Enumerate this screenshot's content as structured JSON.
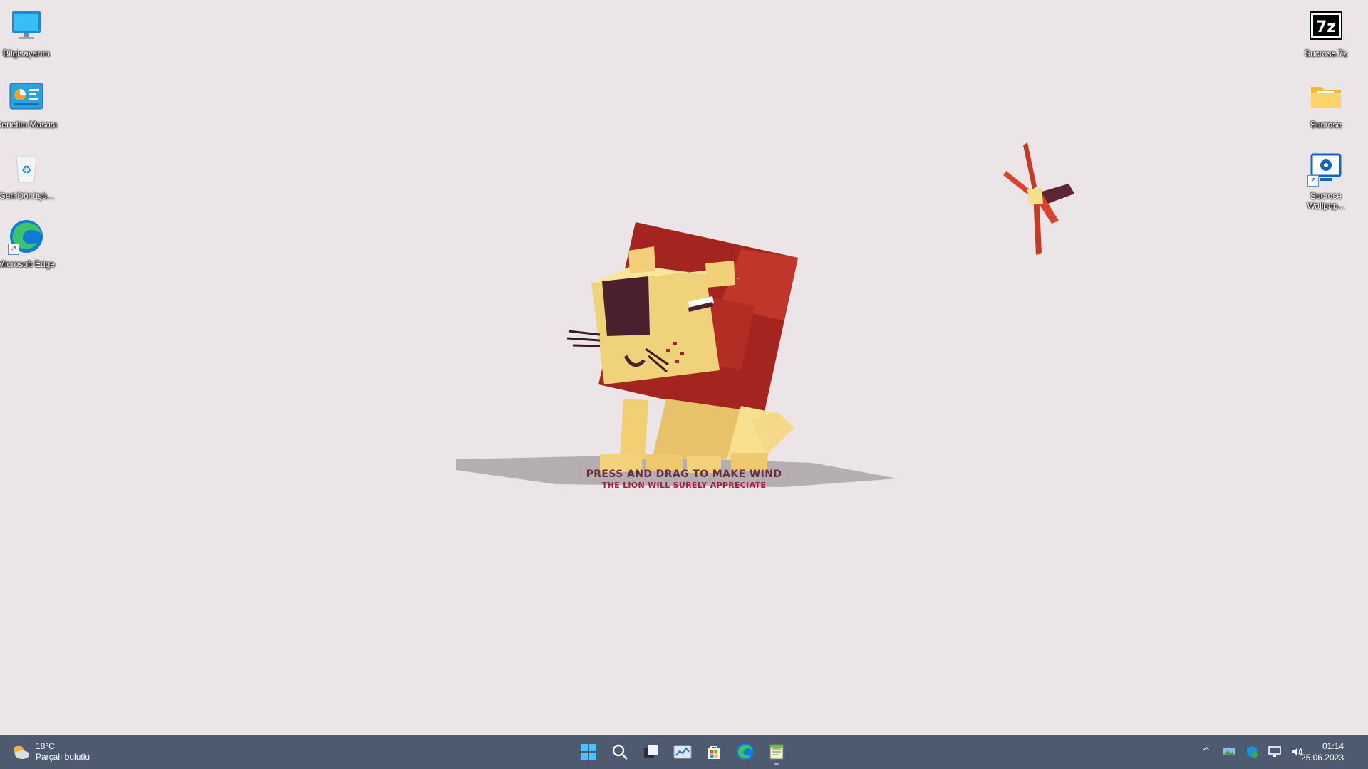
{
  "desktop": {
    "left_icons": [
      {
        "label": "Bilgisayarım"
      },
      {
        "label": "Denetim Masası"
      },
      {
        "label": "Geri Dönüşü..."
      },
      {
        "label": "Microsoft Edge"
      }
    ],
    "right_icons": [
      {
        "label": "Sucrose.7z",
        "glyph": "7z"
      },
      {
        "label": "Sucrose"
      },
      {
        "label": "Sucrose Wallpap..."
      }
    ]
  },
  "wallpaper": {
    "hint_title": "PRESS AND DRAG TO MAKE WIND",
    "hint_subtitle": "THE LION WILL SURELY APPRECIATE"
  },
  "taskbar": {
    "weather": {
      "temp": "18°C",
      "condition": "Parçalı bulutlu"
    },
    "pinned": [
      {
        "icon": "windows-start-icon"
      },
      {
        "icon": "search-icon"
      },
      {
        "icon": "task-view-icon"
      },
      {
        "icon": "widgets-icon"
      },
      {
        "icon": "microsoft-store-icon"
      },
      {
        "icon": "edge-icon"
      },
      {
        "icon": "notepad-app-icon"
      }
    ],
    "tray": {
      "chevron": "^",
      "time": "01:14",
      "date": "25.06.2023"
    }
  }
}
